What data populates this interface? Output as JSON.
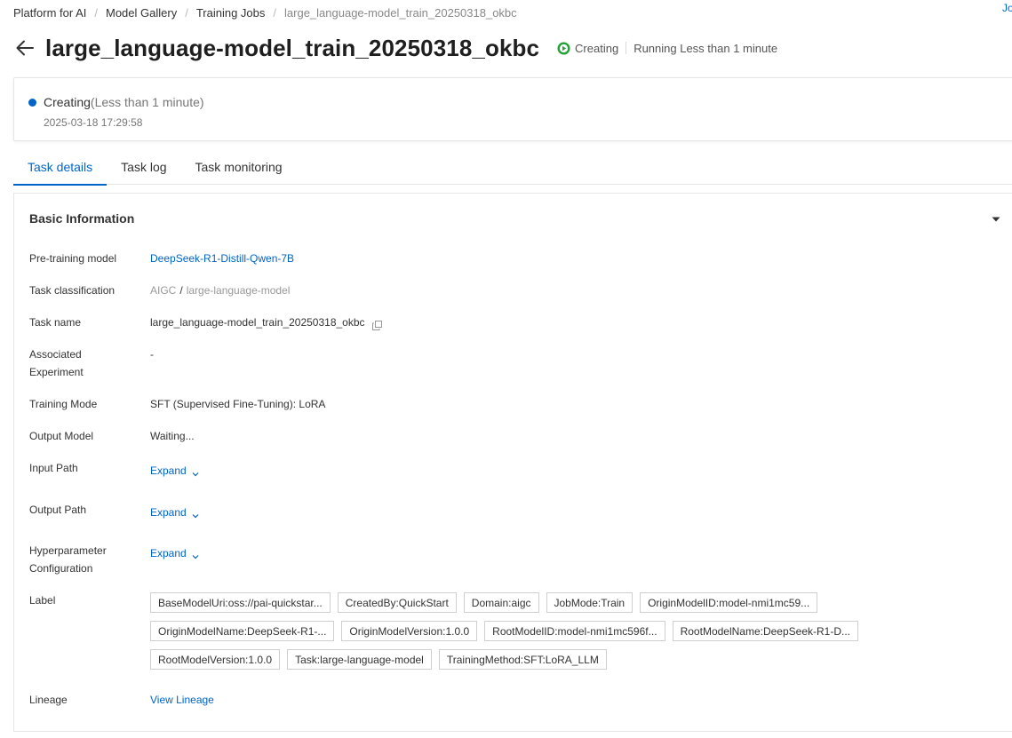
{
  "breadcrumb": {
    "items": [
      "Platform for AI",
      "Model Gallery",
      "Training Jobs",
      "large_language-model_train_20250318_okbc"
    ],
    "separator": "/"
  },
  "user_corner": "Jo",
  "header": {
    "title": "large_language-model_train_20250318_okbc",
    "status_label": "Creating",
    "running_label": "Running Less than 1 minute"
  },
  "status_card": {
    "state": "Creating",
    "duration": "(Less than 1 minute)",
    "timestamp": "2025-03-18 17:29:58"
  },
  "tabs": [
    {
      "label": "Task details",
      "active": true
    },
    {
      "label": "Task log",
      "active": false
    },
    {
      "label": "Task monitoring",
      "active": false
    }
  ],
  "basic_info": {
    "heading": "Basic Information",
    "pretraining_model": {
      "label": "Pre-training model",
      "value": "DeepSeek-R1-Distill-Qwen-7B"
    },
    "task_classification": {
      "label": "Task classification",
      "category": "AIGC",
      "separator": "/",
      "subcategory": "large-language-model"
    },
    "task_name": {
      "label": "Task name",
      "value": "large_language-model_train_20250318_okbc"
    },
    "associated_experiment": {
      "label": "Associated Experiment",
      "value": "-"
    },
    "training_mode": {
      "label": "Training Mode",
      "value": "SFT (Supervised Fine-Tuning): LoRA"
    },
    "output_model": {
      "label": "Output Model",
      "value": "Waiting..."
    },
    "input_path": {
      "label": "Input Path",
      "action": "Expand"
    },
    "output_path": {
      "label": "Output Path",
      "action": "Expand"
    },
    "hyperparameters": {
      "label": "Hyperparameter Configuration",
      "action": "Expand"
    },
    "label": {
      "label": "Label",
      "rows": [
        [
          "BaseModelUri:oss://pai-quickstar...",
          "CreatedBy:QuickStart",
          "Domain:aigc",
          "JobMode:Train",
          "OriginModelID:model-nmi1mc59..."
        ],
        [
          "OriginModelName:DeepSeek-R1-...",
          "OriginModelVersion:1.0.0",
          "RootModelID:model-nmi1mc596f...",
          "RootModelName:DeepSeek-R1-D..."
        ],
        [
          "RootModelVersion:1.0.0",
          "Task:large-language-model",
          "TrainingMethod:SFT:LoRA_LLM"
        ]
      ]
    },
    "lineage": {
      "label": "Lineage",
      "action": "View Lineage"
    }
  },
  "colors": {
    "accent": "#0064c8",
    "status_green": "#21a336",
    "status_dot": "#0064c8"
  },
  "icons": [
    "back-arrow-icon",
    "play-circle-icon",
    "copy-icon",
    "chevron-down-icon",
    "caret-down-icon"
  ]
}
